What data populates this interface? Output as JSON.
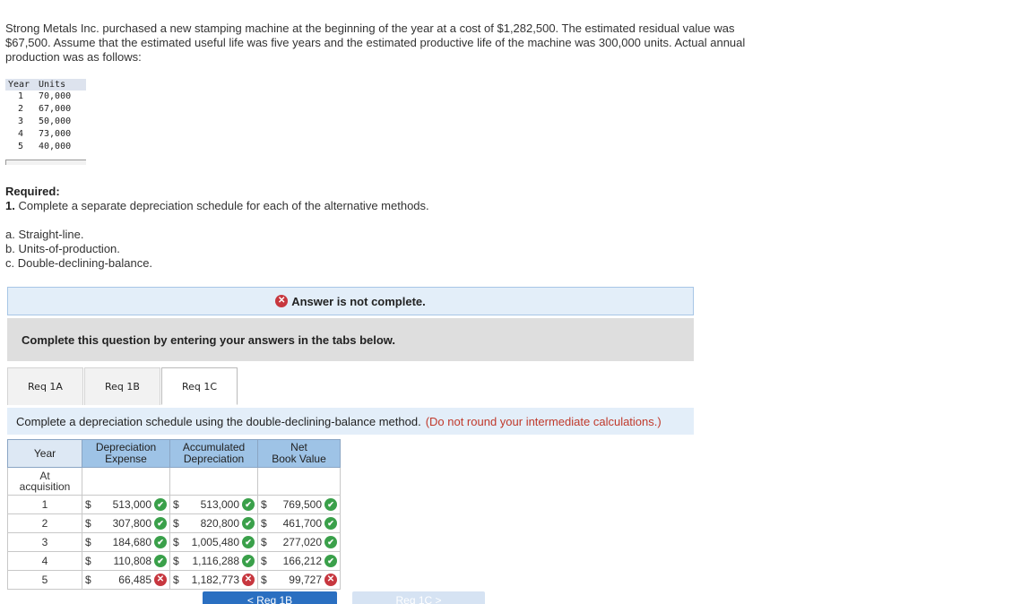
{
  "intro": "Strong Metals Inc. purchased a new stamping machine at the beginning of the year at a cost of $1,282,500. The estimated residual value was $67,500. Assume that the estimated useful life was five years and the estimated productive life of the machine was 300,000 units. Actual annual production was as follows:",
  "units_table": {
    "headers": [
      "Year",
      "Units"
    ],
    "rows": [
      {
        "year": "1",
        "units": "70,000"
      },
      {
        "year": "2",
        "units": "67,000"
      },
      {
        "year": "3",
        "units": "50,000"
      },
      {
        "year": "4",
        "units": "73,000"
      },
      {
        "year": "5",
        "units": "40,000"
      }
    ]
  },
  "required": {
    "title": "Required:",
    "number": "1.",
    "text": "Complete a separate depreciation schedule for each of the alternative methods.",
    "methods": [
      "a. Straight-line.",
      "b. Units-of-production.",
      "c. Double-declining-balance."
    ]
  },
  "status": {
    "icon": "x-circle-icon",
    "text": "Answer is not complete.",
    "color": "#c7373f"
  },
  "instruction": "Complete this question by entering your answers in the tabs below.",
  "tabs": [
    {
      "label": "Req 1A",
      "active": false
    },
    {
      "label": "Req 1B",
      "active": false
    },
    {
      "label": "Req 1C",
      "active": true
    }
  ],
  "tab_instruction": {
    "text": "Complete a depreciation schedule using the double-declining-balance method.",
    "note": "(Do not round your intermediate calculations.)"
  },
  "schedule": {
    "headers": {
      "year": "Year",
      "dep": [
        "Depreciation",
        "Expense"
      ],
      "acc": [
        "Accumulated",
        "Depreciation"
      ],
      "net": [
        "Net",
        "Book Value"
      ]
    },
    "acquisition_label": [
      "At",
      "acquisition"
    ],
    "currency": "$",
    "rows": [
      {
        "year": "1",
        "dep": "513,000",
        "dep_ok": true,
        "acc": "513,000",
        "acc_ok": true,
        "net": "769,500",
        "net_ok": true
      },
      {
        "year": "2",
        "dep": "307,800",
        "dep_ok": true,
        "acc": "820,800",
        "acc_ok": true,
        "net": "461,700",
        "net_ok": true
      },
      {
        "year": "3",
        "dep": "184,680",
        "dep_ok": true,
        "acc": "1,005,480",
        "acc_ok": true,
        "net": "277,020",
        "net_ok": true
      },
      {
        "year": "4",
        "dep": "110,808",
        "dep_ok": true,
        "acc": "1,116,288",
        "acc_ok": true,
        "net": "166,212",
        "net_ok": true
      },
      {
        "year": "5",
        "dep": "66,485",
        "dep_ok": false,
        "acc": "1,182,773",
        "acc_ok": false,
        "net": "99,727",
        "net_ok": false
      }
    ]
  },
  "nav": {
    "prev": "< Req 1B",
    "next": "Req 1C >"
  }
}
